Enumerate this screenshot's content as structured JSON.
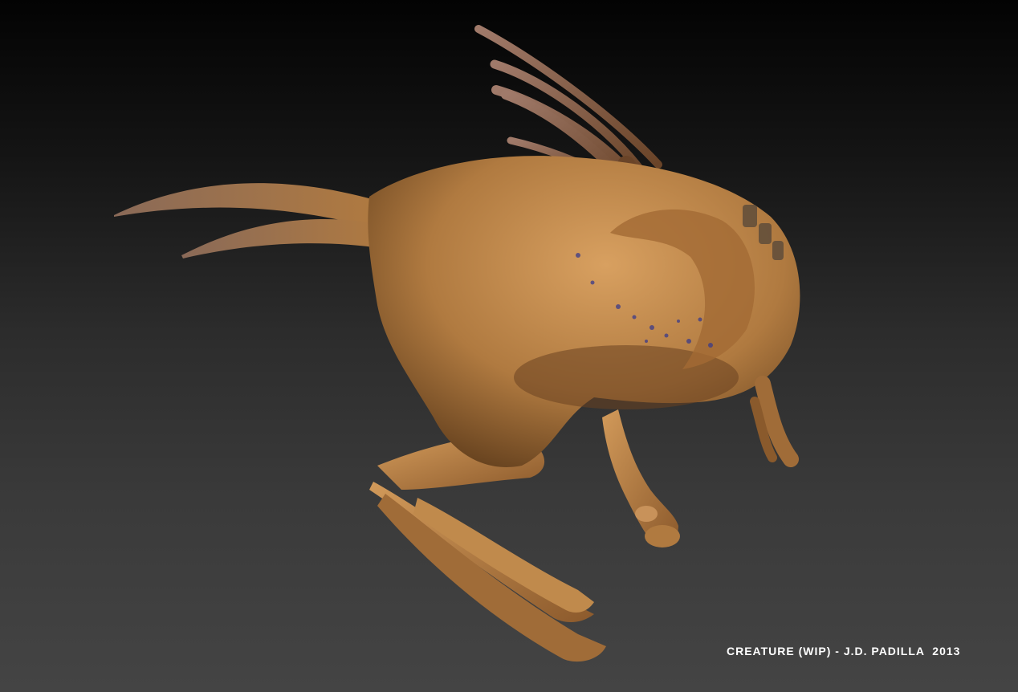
{
  "image": {
    "subject": "sculpted-creature-render",
    "caption": "CREATURE (WIP) - J.D. PADILLA  2013",
    "colors": {
      "background_top": "#030303",
      "background_bottom": "#444444",
      "skin": "#b07a40",
      "skin_highlight": "#d8a060",
      "skin_shadow": "#5c3a1a",
      "horn": "#8a6040",
      "spots": "#3a3a8a",
      "caption_text": "#ffffff"
    }
  }
}
